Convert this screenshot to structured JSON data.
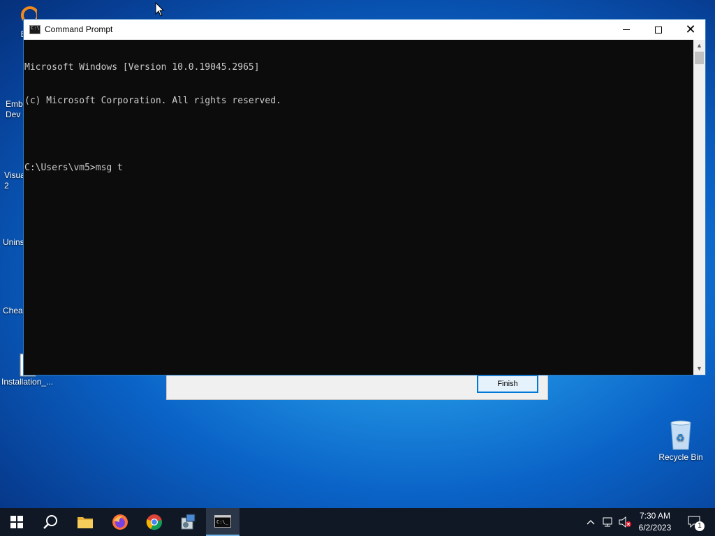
{
  "desktop": {
    "icons": [
      {
        "label": "Ever",
        "icon": "everything-icon"
      },
      {
        "label": "Emba\nDev",
        "icon": "embarcadero-dev-icon"
      },
      {
        "label": "Visua\n2",
        "icon": "visual-studio-icon"
      },
      {
        "label": "Unins",
        "icon": "uninstall-icon"
      },
      {
        "label": "Cheat",
        "icon": "cheat-engine-icon"
      },
      {
        "label": "Installation_...",
        "icon": "document-icon"
      },
      {
        "label": "Recycle Bin",
        "icon": "recycle-bin-icon"
      }
    ]
  },
  "wizard": {
    "finish_label": "Finish"
  },
  "cmd_window": {
    "title": "Command Prompt",
    "lines": [
      "Microsoft Windows [Version 10.0.19045.2965]",
      "(c) Microsoft Corporation. All rights reserved.",
      "",
      "C:\\Users\\vm5>msg t"
    ]
  },
  "taskbar": {
    "items": [
      "start-icon",
      "search-icon",
      "file-explorer-icon",
      "firefox-icon",
      "chrome-icon",
      "installer-icon",
      "command-prompt-icon"
    ],
    "clock_time": "7:30 AM",
    "clock_date": "6/2/2023",
    "notification_count": "1"
  },
  "colors": {
    "console_bg": "#0c0c0c",
    "console_text": "#cccccc",
    "accent": "#0078d7",
    "taskbar_bg": "#101826"
  }
}
